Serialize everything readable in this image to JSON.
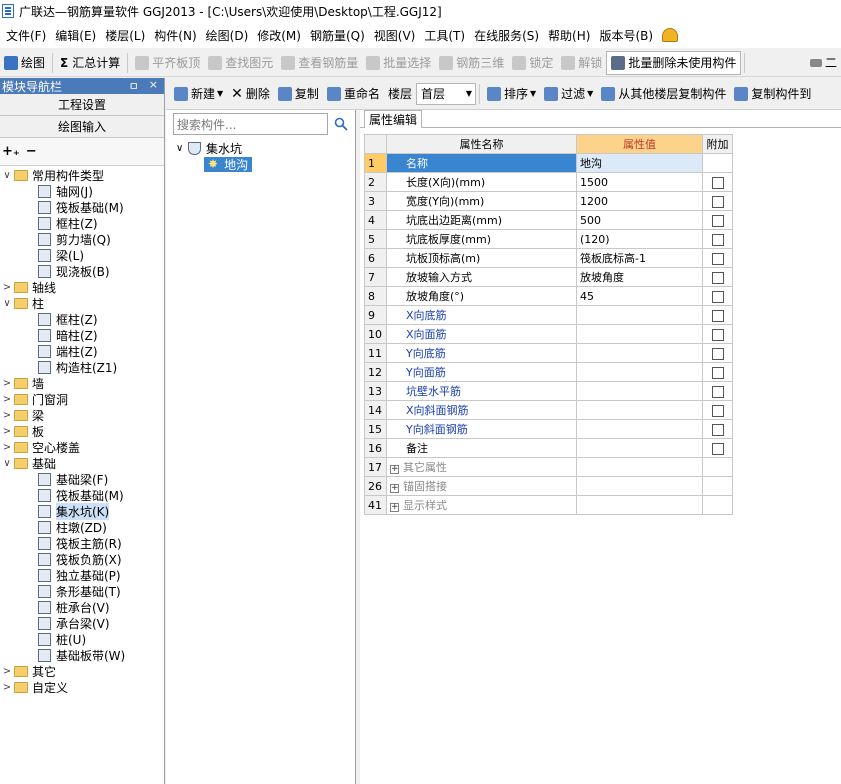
{
  "window": {
    "title": "广联达—钢筋算量软件 GGJ2013 - [C:\\Users\\欢迎使用\\Desktop\\工程.GGJ12]"
  },
  "menu": [
    "文件(F)",
    "编辑(E)",
    "楼层(L)",
    "构件(N)",
    "绘图(D)",
    "修改(M)",
    "钢筋量(Q)",
    "视图(V)",
    "工具(T)",
    "在线服务(S)",
    "帮助(H)",
    "版本号(B)"
  ],
  "toolbar1": {
    "draw": "绘图",
    "sum_calc": "汇总计算",
    "level_slab": "平齐板顶",
    "find_element": "查找图元",
    "view_rebar": "查看钢筋量",
    "batch_select": "批量选择",
    "rebar_3d": "钢筋三维",
    "lock": "锁定",
    "unlock": "解锁",
    "batch_delete": "批量删除未使用构件",
    "overflow": "二"
  },
  "nav": {
    "header": "模块导航栏",
    "header_pin": "ㅁ",
    "header_close": "×",
    "project_settings": "工程设置",
    "drawing_input": "绘图输入",
    "tree": [
      {
        "label": "常用构件类型",
        "type": "folder",
        "exp": "∨",
        "level": 0
      },
      {
        "label": "轴网(J)",
        "type": "item",
        "level": 1
      },
      {
        "label": "筏板基础(M)",
        "type": "item",
        "level": 1
      },
      {
        "label": "框柱(Z)",
        "type": "item",
        "level": 1
      },
      {
        "label": "剪力墙(Q)",
        "type": "item",
        "level": 1
      },
      {
        "label": "梁(L)",
        "type": "item",
        "level": 1
      },
      {
        "label": "现浇板(B)",
        "type": "item",
        "level": 1
      },
      {
        "label": "轴线",
        "type": "folder",
        "exp": ">",
        "level": 0
      },
      {
        "label": "柱",
        "type": "folder",
        "exp": "∨",
        "level": 0
      },
      {
        "label": "框柱(Z)",
        "type": "item",
        "level": 1
      },
      {
        "label": "暗柱(Z)",
        "type": "item",
        "level": 1
      },
      {
        "label": "端柱(Z)",
        "type": "item",
        "level": 1
      },
      {
        "label": "构造柱(Z1)",
        "type": "item",
        "level": 1
      },
      {
        "label": "墙",
        "type": "folder",
        "exp": ">",
        "level": 0
      },
      {
        "label": "门窗洞",
        "type": "folder",
        "exp": ">",
        "level": 0
      },
      {
        "label": "梁",
        "type": "folder",
        "exp": ">",
        "level": 0
      },
      {
        "label": "板",
        "type": "folder",
        "exp": ">",
        "level": 0
      },
      {
        "label": "空心楼盖",
        "type": "folder",
        "exp": ">",
        "level": 0
      },
      {
        "label": "基础",
        "type": "folder",
        "exp": "∨",
        "level": 0
      },
      {
        "label": "基础梁(F)",
        "type": "item",
        "level": 1
      },
      {
        "label": "筏板基础(M)",
        "type": "item",
        "level": 1
      },
      {
        "label": "集水坑(K)",
        "type": "item",
        "level": 1,
        "selected": true
      },
      {
        "label": "柱墩(ZD)",
        "type": "item",
        "level": 1
      },
      {
        "label": "筏板主筋(R)",
        "type": "item",
        "level": 1
      },
      {
        "label": "筏板负筋(X)",
        "type": "item",
        "level": 1
      },
      {
        "label": "独立基础(P)",
        "type": "item",
        "level": 1
      },
      {
        "label": "条形基础(T)",
        "type": "item",
        "level": 1
      },
      {
        "label": "桩承台(V)",
        "type": "item",
        "level": 1
      },
      {
        "label": "承台梁(V)",
        "type": "item",
        "level": 1
      },
      {
        "label": "桩(U)",
        "type": "item",
        "level": 1
      },
      {
        "label": "基础板带(W)",
        "type": "item",
        "level": 1
      },
      {
        "label": "其它",
        "type": "folder",
        "exp": ">",
        "level": 0
      },
      {
        "label": "自定义",
        "type": "folder",
        "exp": ">",
        "level": 0
      }
    ]
  },
  "toolbar2": {
    "new": "新建",
    "delete": "删除",
    "copy": "复制",
    "rename": "重命名",
    "floor_label": "楼层",
    "floor_value": "首层",
    "sort": "排序",
    "filter": "过滤",
    "copy_from_floor": "从其他楼层复制构件",
    "copy_to": "复制构件到"
  },
  "components": {
    "search_placeholder": "搜索构件...",
    "root": "集水坑",
    "child": "地沟"
  },
  "props": {
    "tab": "属性编辑",
    "col_name": "属性名称",
    "col_value": "属性值",
    "col_add": "附加",
    "rows": [
      {
        "num": "1",
        "name": "名称",
        "value": "地沟",
        "style": "sel",
        "check": false
      },
      {
        "num": "2",
        "name": "长度(X向)(mm)",
        "value": "1500",
        "style": "black",
        "check": true
      },
      {
        "num": "3",
        "name": "宽度(Y向)(mm)",
        "value": "1200",
        "style": "black",
        "check": true
      },
      {
        "num": "4",
        "name": "坑底出边距离(mm)",
        "value": "500",
        "style": "black",
        "check": true
      },
      {
        "num": "5",
        "name": "坑底板厚度(mm)",
        "value": "(120)",
        "style": "black",
        "check": true
      },
      {
        "num": "6",
        "name": "坑板顶标高(m)",
        "value": "筏板底标高-1",
        "style": "black",
        "check": true
      },
      {
        "num": "7",
        "name": "放坡输入方式",
        "value": "放坡角度",
        "style": "black",
        "check": true
      },
      {
        "num": "8",
        "name": "放坡角度(°)",
        "value": "45",
        "style": "black",
        "check": true
      },
      {
        "num": "9",
        "name": "X向底筋",
        "value": "",
        "style": "blue",
        "check": true
      },
      {
        "num": "10",
        "name": "X向面筋",
        "value": "",
        "style": "blue",
        "check": true
      },
      {
        "num": "11",
        "name": "Y向底筋",
        "value": "",
        "style": "blue",
        "check": true
      },
      {
        "num": "12",
        "name": "Y向面筋",
        "value": "",
        "style": "blue",
        "check": true
      },
      {
        "num": "13",
        "name": "坑壁水平筋",
        "value": "",
        "style": "blue",
        "check": true
      },
      {
        "num": "14",
        "name": "X向斜面钢筋",
        "value": "",
        "style": "blue",
        "check": true
      },
      {
        "num": "15",
        "name": "Y向斜面钢筋",
        "value": "",
        "style": "blue",
        "check": true
      },
      {
        "num": "16",
        "name": "备注",
        "value": "",
        "style": "black",
        "check": true
      },
      {
        "num": "17",
        "name": "其它属性",
        "value": "",
        "style": "group",
        "check": false
      },
      {
        "num": "26",
        "name": "锚固搭接",
        "value": "",
        "style": "group",
        "check": false
      },
      {
        "num": "41",
        "name": "显示样式",
        "value": "",
        "style": "group",
        "check": false
      }
    ]
  }
}
